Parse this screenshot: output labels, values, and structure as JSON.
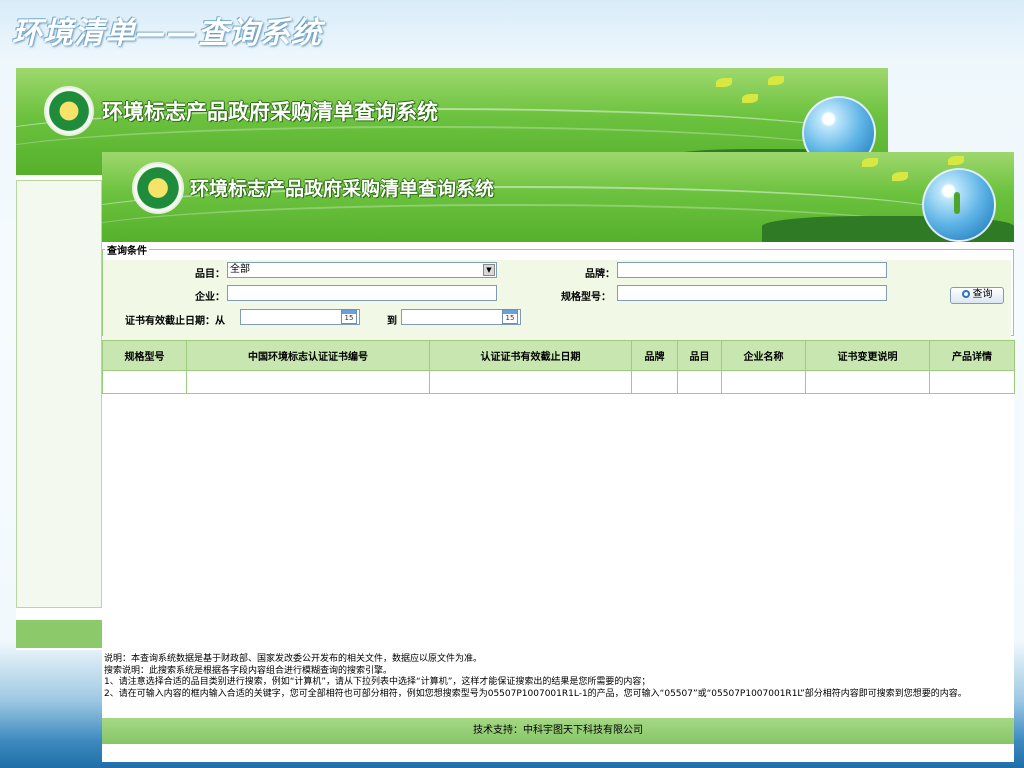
{
  "slide": {
    "title": "环境清单——查询系统"
  },
  "app": {
    "banner_title": "环境标志产品政府采购清单查询系统"
  },
  "query": {
    "legend": "查询条件",
    "category_label": "品目：",
    "category_value": "全部",
    "brand_label": "品牌：",
    "brand_value": "",
    "company_label": "企业：",
    "company_value": "",
    "model_label": "规格型号：",
    "model_value": "",
    "expiry_label": "证书有效截止日期：从",
    "expiry_from_value": "",
    "expiry_to_label": "到",
    "expiry_to_value": "",
    "calendar_day": "15",
    "search_button": "查询"
  },
  "table": {
    "headers": [
      "规格型号",
      "中国环境标志认证证书编号",
      "认证证书有效截止日期",
      "品牌",
      "品目",
      "企业名称",
      "证书变更说明",
      "产品详情"
    ],
    "rows": [
      [
        "",
        "",
        "",
        "",
        "",
        "",
        "",
        ""
      ]
    ]
  },
  "notes": {
    "line1": "说明：本查询系统数据是基于财政部、国家发改委公开发布的相关文件，数据应以原文件为准。",
    "line2": "搜索说明：此搜索系统是根据各字段内容组合进行模糊查询的搜索引擎。",
    "line3": "1、请注意选择合适的品目类别进行搜索，例如“计算机”，请从下拉列表中选择“计算机”，这样才能保证搜索出的结果是您所需要的内容；",
    "line4": "2、请在可输入内容的框内输入合适的关键字，您可全部相符也可部分相符，例如您想搜索型号为05507P1007001R1L-1的产品，您可输入“05507”或“05507P1007001R1L”部分相符内容即可搜索到您想要的内容。"
  },
  "footer": {
    "text": "技术支持：中科宇图天下科技有限公司"
  },
  "colors": {
    "banner_green": "#6cc23f",
    "header_green": "#c8e6b0",
    "panel_bg": "#f1f9e6",
    "footer_green": "#86c666"
  },
  "icons": {
    "logo": "environmental-label-logo",
    "calendar": "calendar-icon",
    "search": "magnifier-icon",
    "globe": "globe-sprout-icon"
  }
}
